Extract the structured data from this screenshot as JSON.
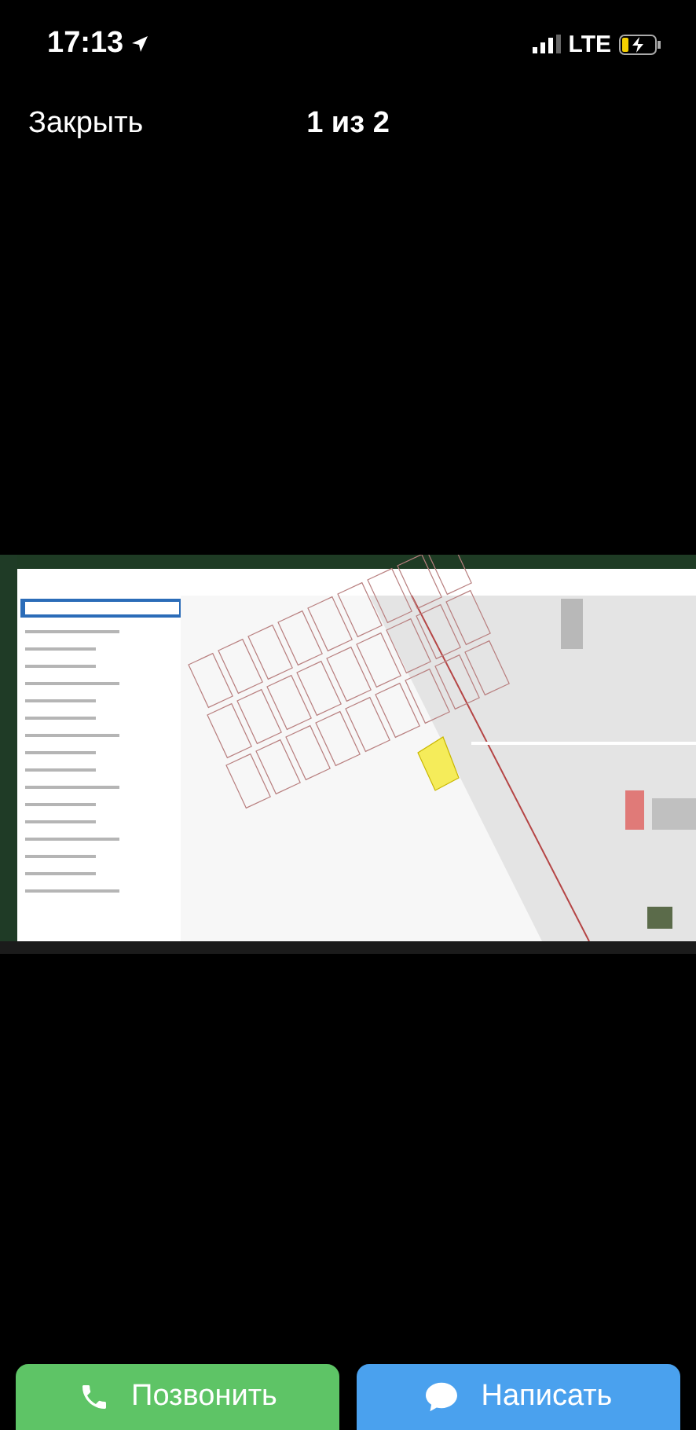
{
  "status_bar": {
    "time": "17:13",
    "network": "LTE",
    "charging": true
  },
  "nav": {
    "close": "Закрыть",
    "counter": "1 из 2"
  },
  "actions": [
    {
      "kind": "call",
      "label": "Позвонить"
    },
    {
      "kind": "message",
      "label": "Написать"
    }
  ]
}
